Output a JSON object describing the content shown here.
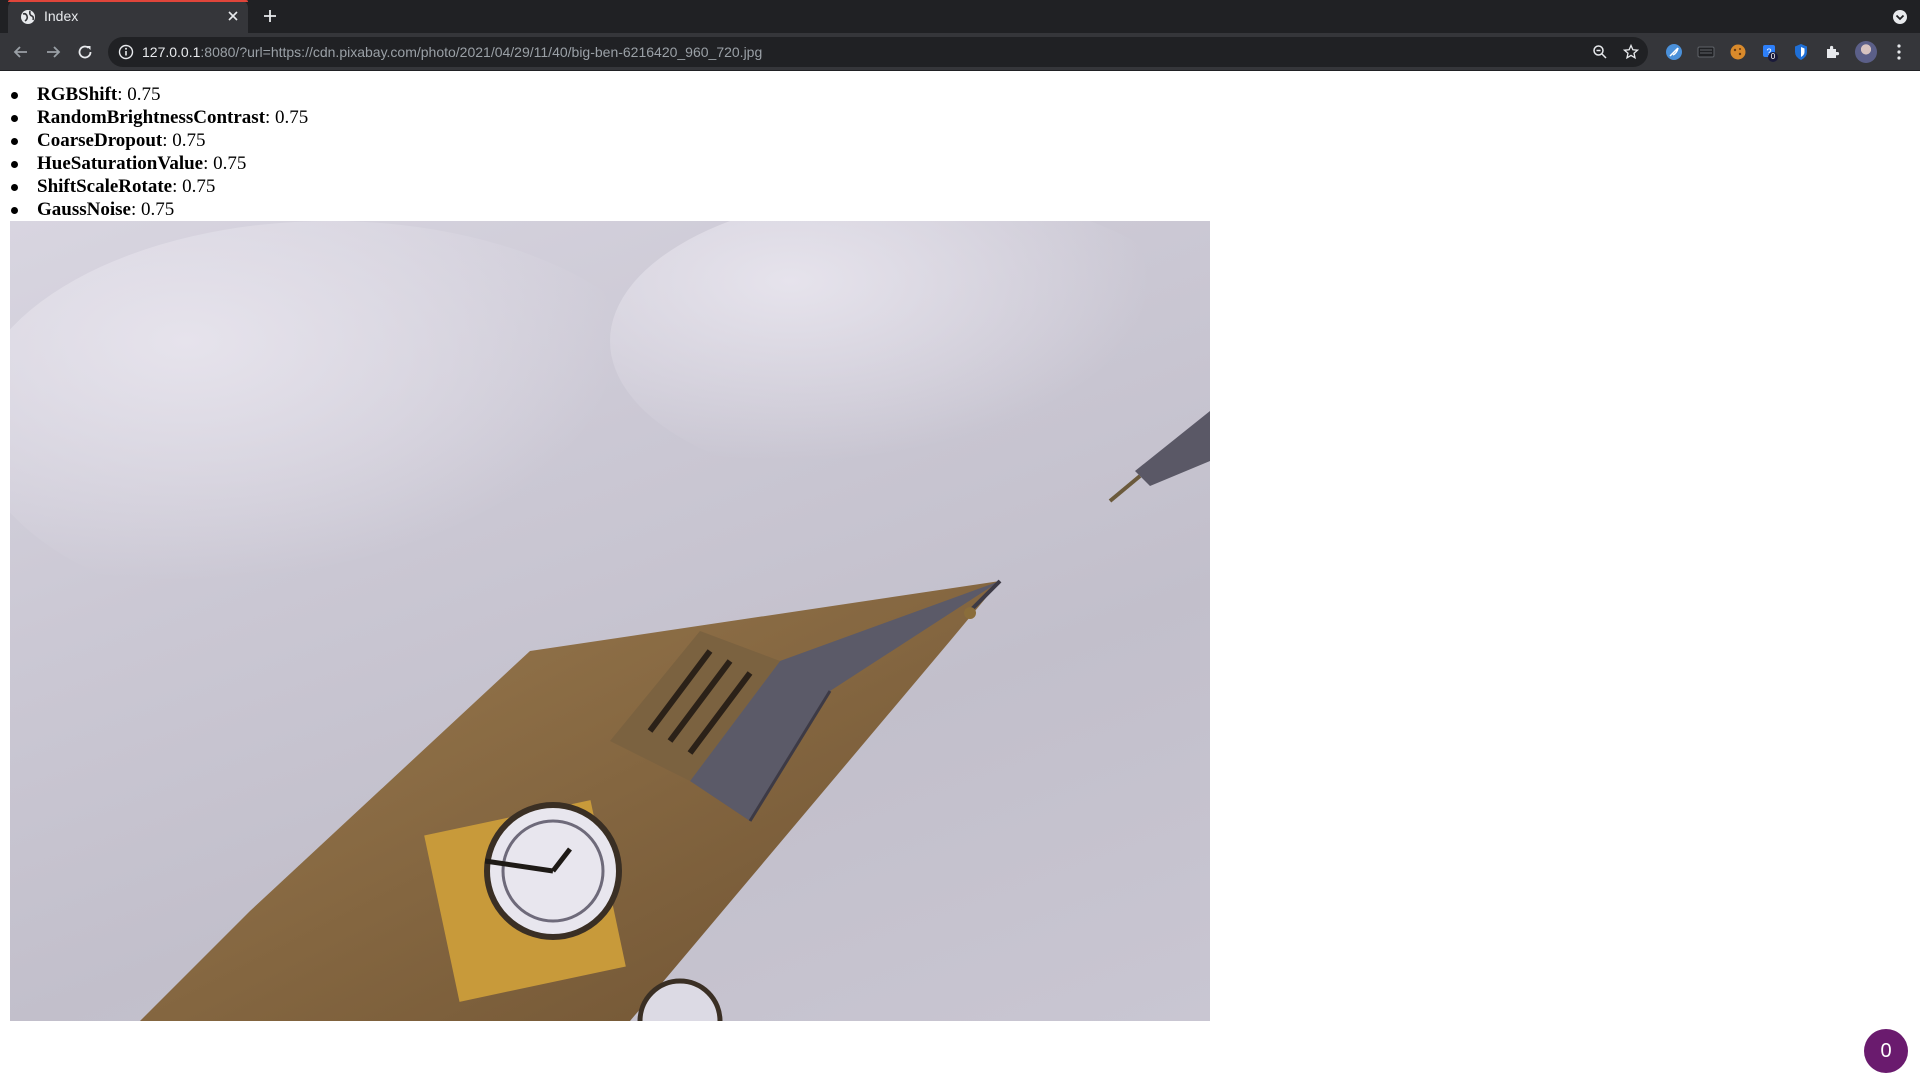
{
  "browser": {
    "tab_title": "Index",
    "url_host": "127.0.0.1",
    "url_rest": ":8080/?url=https://cdn.pixabay.com/photo/2021/04/29/11/40/big-ben-6216420_960_720.jpg",
    "extension_badge": "0"
  },
  "params": [
    {
      "name": "RGBShift",
      "value": ": 0.75"
    },
    {
      "name": "RandomBrightnessContrast",
      "value": ": 0.75"
    },
    {
      "name": "CoarseDropout",
      "value": ": 0.75"
    },
    {
      "name": "HueSaturationValue",
      "value": ": 0.75"
    },
    {
      "name": "ShiftScaleRotate",
      "value": ": 0.75"
    },
    {
      "name": "GaussNoise",
      "value": ": 0.75"
    }
  ],
  "image": {
    "subject": "big-ben-clock-tower"
  },
  "counter_button": "0",
  "colors": {
    "tab_accent": "#e0453a",
    "counter_bg": "#6a1b6e"
  }
}
